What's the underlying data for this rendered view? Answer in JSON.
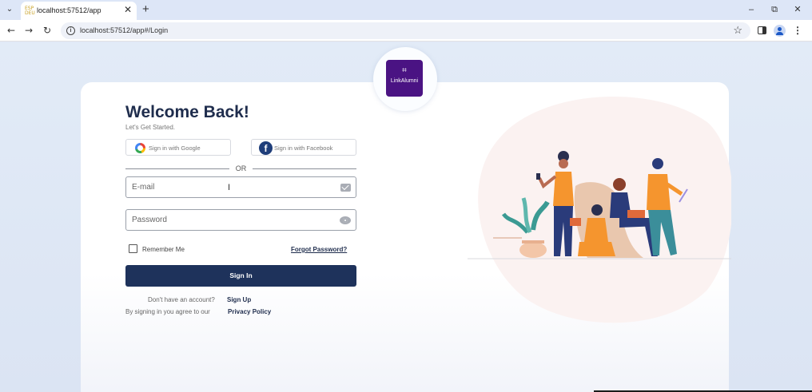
{
  "browser": {
    "tab_title": "localhost:57512/app",
    "favicon_text": "ESP\nDEU",
    "url": "localhost:57512/app#/Login"
  },
  "logo": {
    "text": "LinkAlumni",
    "mark": "⌗"
  },
  "login": {
    "title": "Welcome Back!",
    "subtitle": "Let's Get Started.",
    "google_label": "Sign in with Google",
    "facebook_label": "Sign in with Facebook",
    "facebook_letter": "f",
    "or_text": "OR",
    "email_placeholder": "E-mail",
    "password_placeholder": "Password",
    "remember_label": "Remember Me",
    "forgot_label": "Forgot Password?",
    "signin_label": "Sign In",
    "no_account_text": "Don't have an account?",
    "signup_label": "Sign Up",
    "agree_text": "By signing in you agree to our",
    "privacy_label": "Privacy Policy"
  },
  "colors": {
    "brand_purple": "#4a1383",
    "primary_navy": "#1e325b",
    "accent_orange": "#f5952e"
  }
}
